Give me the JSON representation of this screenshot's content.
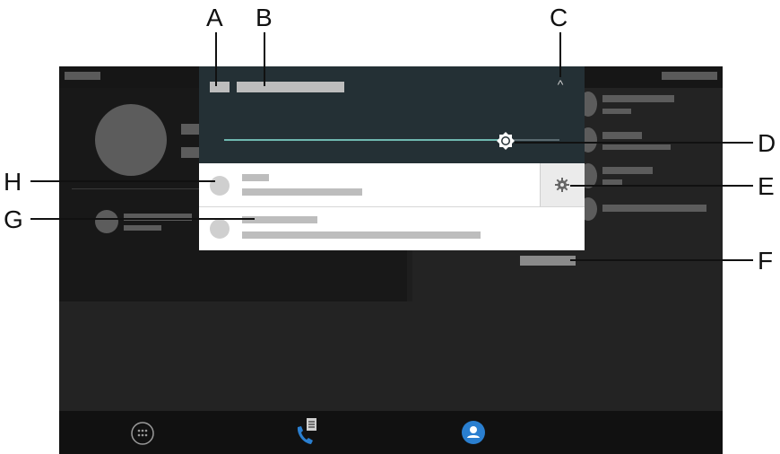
{
  "callouts": {
    "a": "A",
    "b": "B",
    "c": "C",
    "d": "D",
    "e": "E",
    "f": "F",
    "g": "G",
    "h": "H"
  },
  "quick_panel": {
    "collapse_glyph": "^",
    "brightness_level": 0.75,
    "settings_icon": "gear-icon"
  },
  "navbar": {
    "icons": [
      "apps-icon",
      "phone-list-icon",
      "contact-icon"
    ]
  },
  "colors": {
    "panel_bg": "#243035",
    "slider_track": "#6fb8b0",
    "screen_bg": "#1e1e1e",
    "nav_bg": "#111111",
    "notification_bg": "#ffffff",
    "placeholder": "#bdbdbd",
    "accent_blue": "#2a7fd0"
  }
}
